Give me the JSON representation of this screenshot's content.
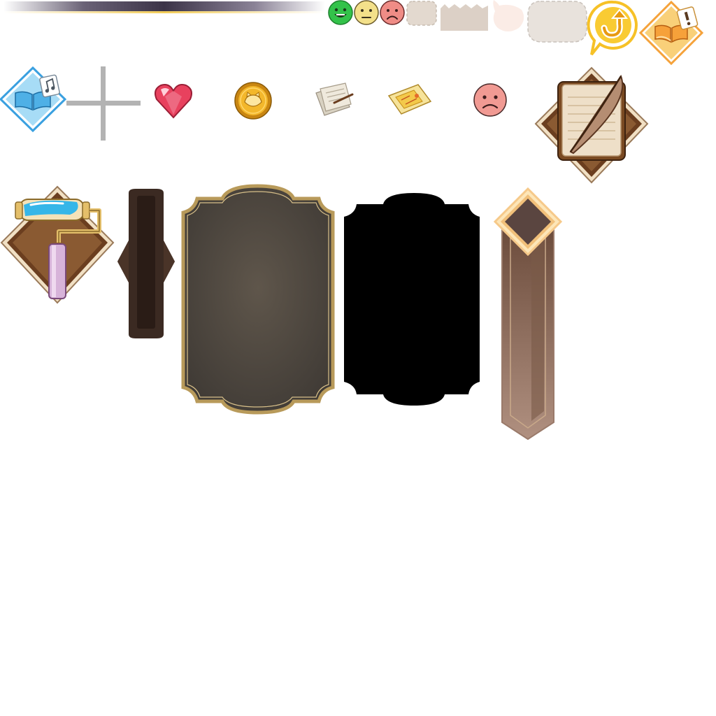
{
  "atlas": {
    "background": "#ffffff",
    "row1": {
      "gradient_bar": {
        "colors": [
          "#ffffff",
          "#4a4258",
          "#f4d26a",
          "#ffffff"
        ]
      },
      "moods": [
        {
          "name": "happy-face-icon",
          "color": "#33c24a",
          "mood": "happy"
        },
        {
          "name": "neutral-face-icon",
          "color": "#f3e08a",
          "mood": "neutral"
        },
        {
          "name": "sad-face-icon",
          "color": "#ef8c86",
          "mood": "sad"
        }
      ],
      "bubbles": [
        "dashed-box",
        "torn-box",
        "faint-speech-bubble",
        "dashed-speech-bubble"
      ],
      "refresh_icon": {
        "color": "#f6c127"
      },
      "story_alert_icon": {
        "color": "#f5b340"
      }
    },
    "row2": {
      "music_book_icon": {
        "color": "#5fb7ea"
      },
      "crosshair": {
        "color": "#b3b3b3"
      },
      "heart_gem_icon": {
        "color": "#e8415e"
      },
      "gold_coin_icon": {
        "color": "#e7a51f"
      },
      "papers_icon": {
        "color": "#e7e1d3"
      },
      "map_icon": {
        "color": "#f3d46a"
      },
      "sad_face_icon": {
        "color": "#f19a93"
      },
      "quill_notebook_icon": {
        "color": "#6b3e1f"
      }
    },
    "row3": {
      "paint_roller_icon": {
        "color": "#7a4a22"
      },
      "narrow_panel": {
        "color": "#3b2a22"
      },
      "ornate_frame": {
        "fill": "#5a5248",
        "border": "#b89a5a"
      },
      "black_frame": {
        "fill": "#000000"
      },
      "banner_pillar": {
        "fill": "#8c6a55",
        "gem": "#5a4540"
      }
    }
  }
}
